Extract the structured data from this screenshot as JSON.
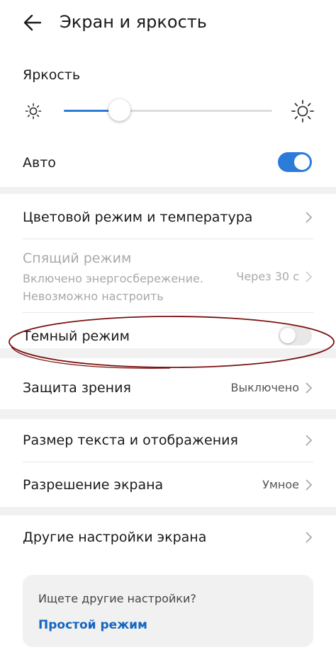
{
  "header": {
    "title": "Экран и яркость"
  },
  "brightness": {
    "label": "Яркость",
    "level": 0.27
  },
  "auto": {
    "label": "Авто",
    "enabled": true
  },
  "settings": {
    "color_mode": {
      "label": "Цветовой режим и температура"
    },
    "sleep": {
      "label": "Спящий режим",
      "note_line1": "Включено энергосбережение.",
      "note_line2": "Невозможно настроить",
      "value": "Через 30 с"
    },
    "dark_mode": {
      "label": "Темный режим",
      "enabled": false
    },
    "eye_comfort": {
      "label": "Защита зрения",
      "value": "Выключено"
    },
    "text_size": {
      "label": "Размер текста и отображения"
    },
    "resolution": {
      "label": "Разрешение экрана",
      "value": "Умное"
    },
    "other": {
      "label": "Другие настройки экрана"
    }
  },
  "search": {
    "question": "Ищете другие настройки?",
    "link": "Простой режим"
  },
  "colors": {
    "accent": "#2d7bd9",
    "link": "#1565c0",
    "annotation": "#7a1010"
  },
  "icons": {
    "back": "arrow-left-icon",
    "sun_small": "sun-dim-icon",
    "sun_large": "sun-bright-icon",
    "chevron": "chevron-right-icon"
  }
}
